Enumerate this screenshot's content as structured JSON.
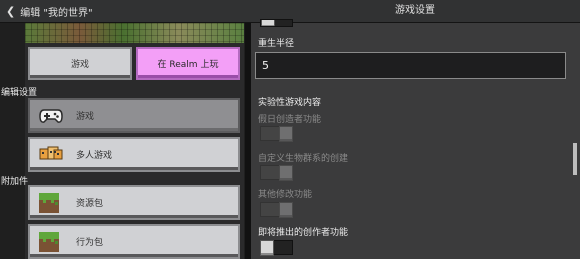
{
  "header": {
    "back_label": "编辑 \"我的世界\"",
    "title": "游戏设置"
  },
  "left": {
    "play_label": "游戏",
    "realm_label": "在 Realm 上玩",
    "edit_section": "编辑设置",
    "nav": [
      {
        "label": "游戏",
        "icon": "controller-icon",
        "active": true
      },
      {
        "label": "多人游戏",
        "icon": "multiplayer-icon",
        "active": false
      }
    ],
    "addons_section": "附加件",
    "addons": [
      {
        "label": "资源包",
        "icon": "grass-block-icon"
      },
      {
        "label": "行为包",
        "icon": "grass-block-icon"
      }
    ]
  },
  "right": {
    "respawn_label": "重生半径",
    "respawn_value": "5",
    "experimental_label": "实验性游戏内容",
    "toggles": [
      {
        "label": "假日创造者功能",
        "enabled": false
      },
      {
        "label": "自定义生物群系的创建",
        "enabled": false
      },
      {
        "label": "其他修改功能",
        "enabled": false
      },
      {
        "label": "即将推出的创作者功能",
        "enabled": true
      }
    ]
  },
  "colors": {
    "realm_button": "#f39ff7",
    "button_light": "#d0d1d4",
    "button_active": "#8f8f92",
    "panel_right": "#3b3b3c"
  }
}
